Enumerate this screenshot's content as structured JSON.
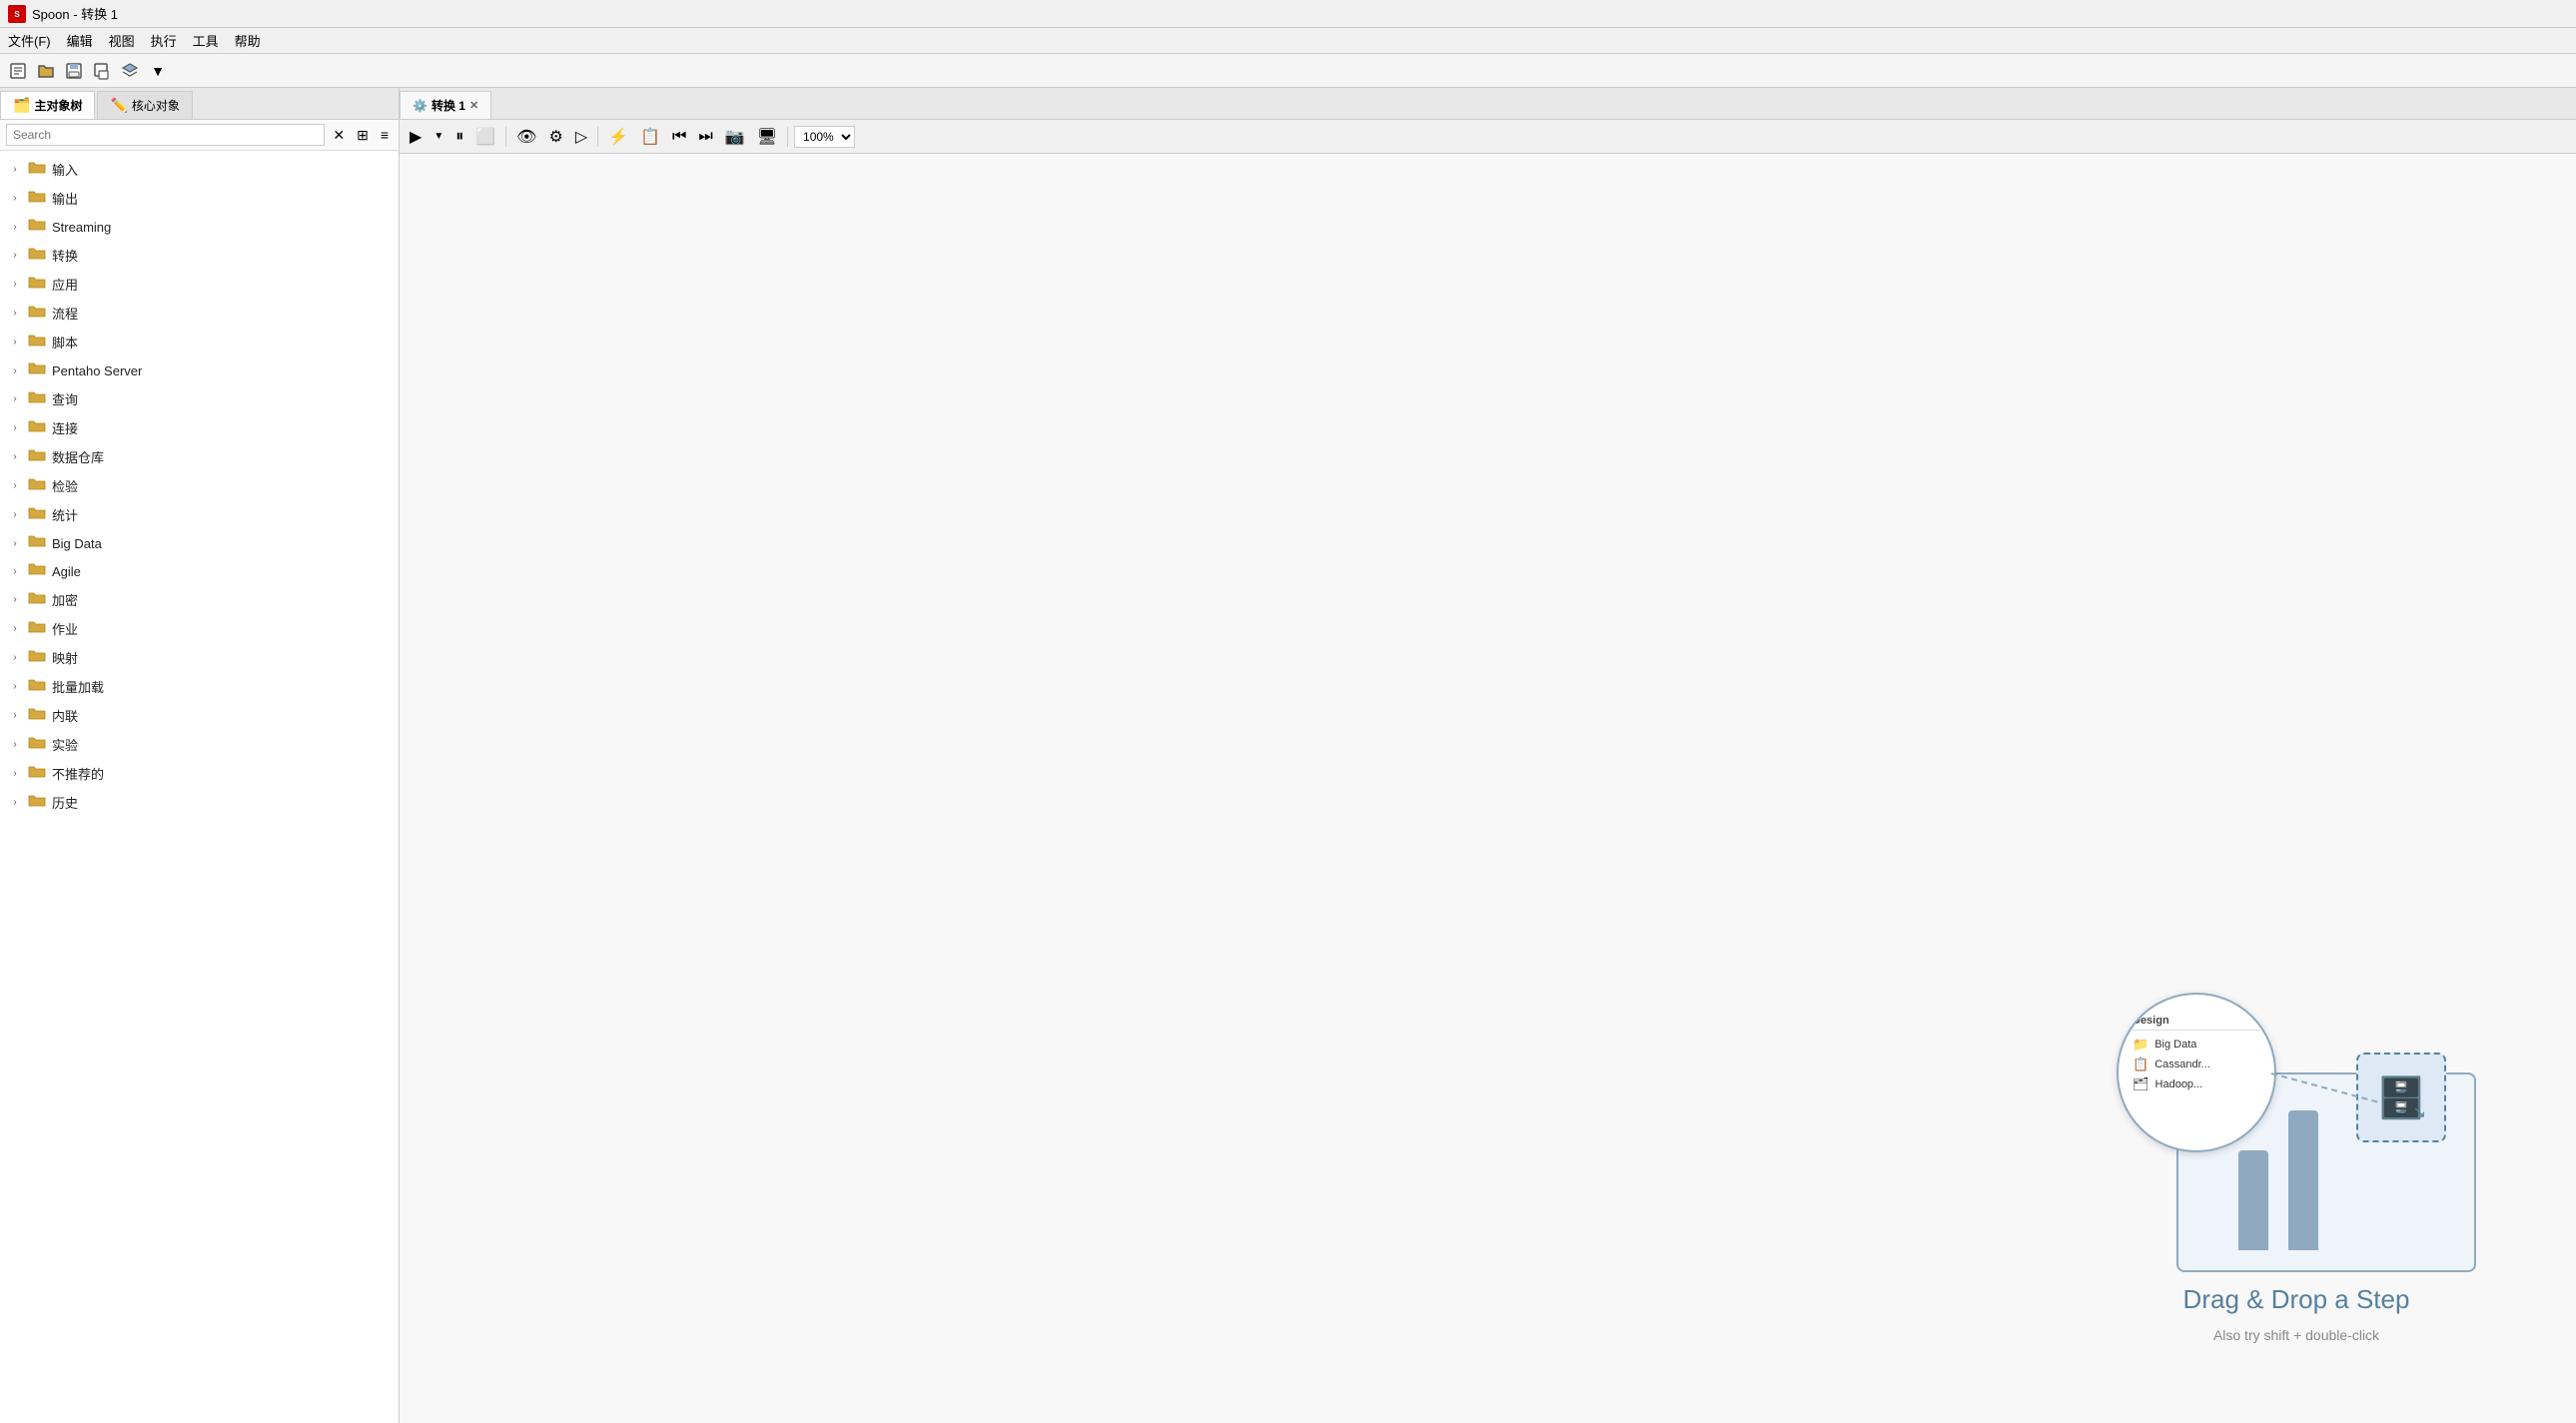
{
  "titleBar": {
    "appName": "Spoon - 转换 1",
    "appIconText": "S"
  },
  "menuBar": {
    "items": [
      "文件(F)",
      "编辑",
      "视图",
      "执行",
      "工具",
      "帮助"
    ]
  },
  "toolbar": {
    "buttons": [
      "📄",
      "📂",
      "💾",
      "🖨️",
      "📋",
      "▼"
    ]
  },
  "leftPanel": {
    "tabs": [
      {
        "label": "主对象树",
        "icon": "🗂️",
        "active": true
      },
      {
        "label": "核心对象",
        "icon": "✏️",
        "active": false
      }
    ],
    "search": {
      "placeholder": "Search",
      "clearBtn": "✕",
      "optionBtns": [
        "⊞",
        "≡"
      ]
    },
    "treeItems": [
      {
        "label": "输入",
        "hasArrow": true
      },
      {
        "label": "输出",
        "hasArrow": true
      },
      {
        "label": "Streaming",
        "hasArrow": true
      },
      {
        "label": "转换",
        "hasArrow": true
      },
      {
        "label": "应用",
        "hasArrow": true
      },
      {
        "label": "流程",
        "hasArrow": true
      },
      {
        "label": "脚本",
        "hasArrow": true
      },
      {
        "label": "Pentaho Server",
        "hasArrow": true
      },
      {
        "label": "查询",
        "hasArrow": true
      },
      {
        "label": "连接",
        "hasArrow": true
      },
      {
        "label": "数据仓库",
        "hasArrow": true
      },
      {
        "label": "检验",
        "hasArrow": true
      },
      {
        "label": "统计",
        "hasArrow": true
      },
      {
        "label": "Big Data",
        "hasArrow": true
      },
      {
        "label": "Agile",
        "hasArrow": true
      },
      {
        "label": "加密",
        "hasArrow": true
      },
      {
        "label": "作业",
        "hasArrow": true
      },
      {
        "label": "映射",
        "hasArrow": true
      },
      {
        "label": "批量加载",
        "hasArrow": true
      },
      {
        "label": "内联",
        "hasArrow": true
      },
      {
        "label": "实验",
        "hasArrow": true
      },
      {
        "label": "不推荐的",
        "hasArrow": true
      },
      {
        "label": "历史",
        "hasArrow": true
      }
    ]
  },
  "rightPanel": {
    "tab": {
      "icon": "⚙️",
      "label": "转换 1",
      "closeBtn": "✕"
    },
    "canvasToolbar": {
      "runBtn": "▶",
      "runDropBtn": "▼",
      "pauseBtn": "⏸",
      "stopBtn": "⬜",
      "previewBtn": "👁",
      "otherBtns": [
        "⚙",
        "▷",
        "⚡",
        "📋",
        "⏮",
        "⏭",
        "📷",
        "🖥"
      ],
      "zoom": "100%"
    },
    "canvas": {
      "empty": true
    },
    "dndIllustration": {
      "magnifier": {
        "title": "Design",
        "items": [
          {
            "icon": "📁",
            "label": "Big Data"
          },
          {
            "icon": "📋",
            "label": "Cassandr..."
          },
          {
            "icon": "🗂",
            "label": "Hadoop..."
          }
        ]
      },
      "dragText": "Drag & Drop a Step",
      "dragSubtext": "Also try shift + double-click"
    }
  }
}
